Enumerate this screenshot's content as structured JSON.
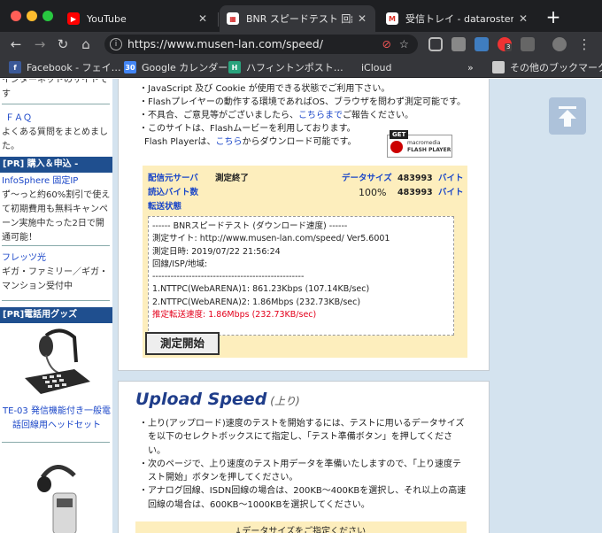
{
  "browser": {
    "tabs": [
      {
        "label": "YouTube",
        "active": false,
        "favicon": "youtube-icon"
      },
      {
        "label": "BNR スピードテスト 回線速度",
        "active": true,
        "favicon": "bnr-icon"
      },
      {
        "label": "受信トレイ - dataroster@gm",
        "active": false,
        "favicon": "gmail-icon"
      }
    ],
    "url": "https://www.musen-lan.com/speed/",
    "bookmarks": [
      {
        "label": "Facebook - フェイ…",
        "icon": "facebook-icon"
      },
      {
        "label": "Google カレンダー",
        "icon": "calendar-icon"
      },
      {
        "label": "ハフィントンポスト…",
        "icon": "huffpost-icon"
      },
      {
        "label": "iCloud",
        "icon": "apple-icon"
      }
    ],
    "other_bookmarks": "その他のブックマーク",
    "calendar_day": "30",
    "extension_badge": "3"
  },
  "sidebar": {
    "top_text": "インターネットのサイトです",
    "faq_link": "ＦＡＱ",
    "faq_desc": "よくある質問をまとめました。",
    "section_buy": "[PR] 購入＆申込 -",
    "infosphere_link": "InfoSphere 固定IP",
    "infosphere_desc": "ず〜っと約60%割引で使えて初期費用も無料キャンペーン実施中たった2日で開通可能！",
    "flets_link": "フレッツ光",
    "flets_desc": "ギガ・ファミリー／ギガ・マンション受付中",
    "section_phone": "[PR]電話用グッズ",
    "headset_link": "TE-03 発信機能付き一般電話回線用ヘッドセット"
  },
  "download": {
    "bullets": [
      "・JavaScript 及び Cookie が使用できる状態でご利用下さい。",
      "・Flashプレイヤーの動作する環境であればOS、ブラウザを問わず測定可能です。",
      "・不具合、ご意見等がございましたら、",
      "こちらまで",
      "ご報告ください。",
      "・このサイトは、Flashムービーを利用しております。",
      "Flash Playerは、",
      "こちら",
      "からダウンロード可能です。"
    ],
    "flash_badge": {
      "get": "GET",
      "brand": "macromedia",
      "product": "FLASH PLAYER"
    },
    "server_label": "配信元サーバ",
    "status": "測定終了",
    "datasize_label": "データサイズ",
    "datasize_value": "483993",
    "byte_unit": "バイト",
    "read_label": "読込バイト数",
    "progress": "100%",
    "read_value": "483993",
    "transfer_label": "転送状態",
    "result_lines": [
      "------ BNRスピードテスト (ダウンロード速度) ------",
      "測定サイト: http://www.musen-lan.com/speed/ Ver5.6001",
      "測定日時: 2019/07/22 21:56:24",
      "回線/ISP/地域:",
      "--------------------------------------------------",
      "1.NTTPC(WebARENA)1: 861.23Kbps (107.14KB/sec)",
      "2.NTTPC(WebARENA)2: 1.86Mbps (232.73KB/sec)",
      "推定転送速度: 1.86Mbps (232.73KB/sec)"
    ],
    "start_button": "測定開始"
  },
  "upload": {
    "title": "Upload Speed",
    "title_sub": "(上り)",
    "bullets": [
      "・上り(アップロード)速度のテストを開始するには、テストに用いるデータサイズを以下のセレクトボックスにて指定し、「テスト準備ボタン」を押してください。",
      "・次のページで、上り速度のテスト用データを準備いたしますので、「上り速度テスト開始」ボタンを押してください。",
      "・アナログ回線、ISDN回線の場合は、200KB〜400KBを選択し、それ以上の高速回線の場合は、600KB〜1000KBを選択してください。"
    ],
    "partial_label": "↓データサイズをご指定ください"
  },
  "colors": {
    "tabbar": "#1e1f22",
    "toolbar": "#35363a",
    "sidebar_header": "#1f4f8f",
    "link": "#1a46c8",
    "panel": "#fdeebd",
    "pane_bg": "#d4e3ef",
    "result_red": "#e3001b"
  }
}
